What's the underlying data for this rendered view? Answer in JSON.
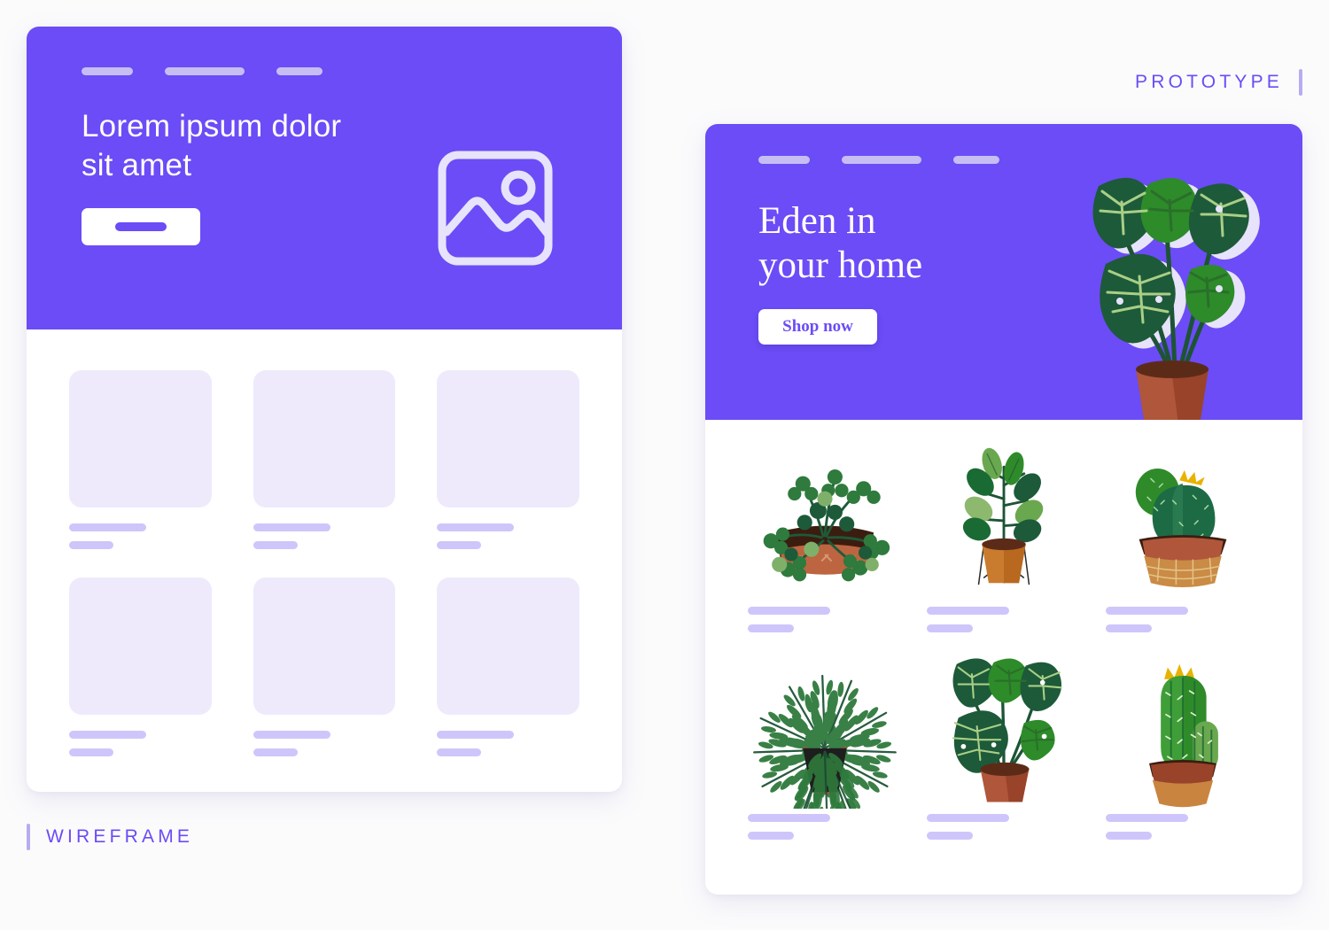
{
  "colors": {
    "accent": "#6b4cf6",
    "pill": "#c6bef3",
    "line": "#cec6fa",
    "placeholder_box": "#eeeafc",
    "card_bg": "#ffffff",
    "page_bg": "#fbfbfc",
    "label_bar": "#b7abf2"
  },
  "labels": {
    "wireframe": "WIREFRAME",
    "prototype": "PROTOTYPE"
  },
  "wireframe": {
    "nav": [
      {
        "name": "nav-pill-1"
      },
      {
        "name": "nav-pill-2"
      },
      {
        "name": "nav-pill-3"
      }
    ],
    "hero": {
      "title": "Lorem ipsum dolor sit amet",
      "cta_label": "",
      "image_placeholder_icon": "image-placeholder-icon"
    },
    "products": [
      {
        "line_long": "",
        "line_short": ""
      },
      {
        "line_long": "",
        "line_short": ""
      },
      {
        "line_long": "",
        "line_short": ""
      },
      {
        "line_long": "",
        "line_short": ""
      },
      {
        "line_long": "",
        "line_short": ""
      },
      {
        "line_long": "",
        "line_short": ""
      }
    ]
  },
  "prototype": {
    "nav": [
      {
        "name": "nav-pill-1"
      },
      {
        "name": "nav-pill-2"
      },
      {
        "name": "nav-pill-3"
      }
    ],
    "hero": {
      "title_line1": "Eden in",
      "title_line2": "your home",
      "cta_label": "Shop now",
      "illustration": "alocasia-plant-illustration"
    },
    "products": [
      {
        "illustration": "trailing-vine-plant-illustration"
      },
      {
        "illustration": "rubber-plant-on-stand-illustration"
      },
      {
        "illustration": "prickly-pear-cactus-illustration"
      },
      {
        "illustration": "parlor-palm-illustration"
      },
      {
        "illustration": "alocasia-plant-illustration"
      },
      {
        "illustration": "column-cactus-illustration"
      }
    ]
  }
}
